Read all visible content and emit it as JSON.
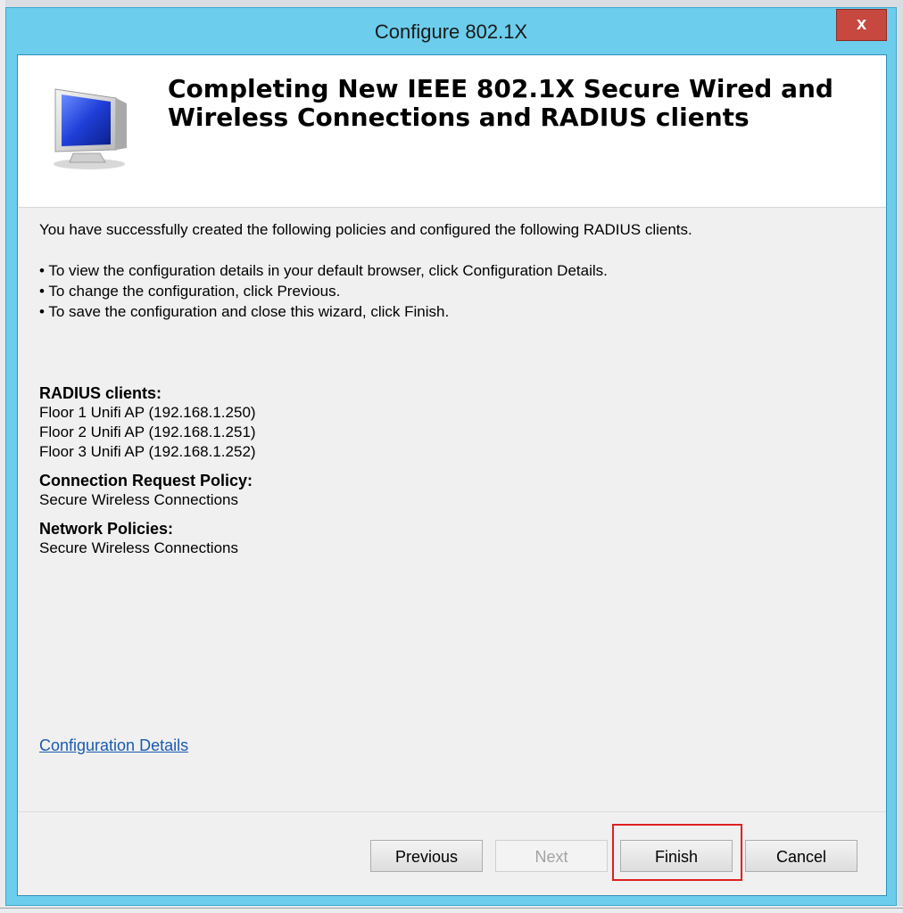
{
  "window": {
    "title": "Configure 802.1X",
    "close_label": "x"
  },
  "header": {
    "heading": "Completing New IEEE 802.1X Secure Wired and Wireless Connections and RADIUS clients",
    "icon": "computer-monitor-icon"
  },
  "body": {
    "intro": "You have successfully created the following policies and configured the following RADIUS clients.",
    "bullets": [
      "• To view the configuration details in your default browser, click Configuration Details.",
      "• To change the configuration, click Previous.",
      "• To save the configuration and close this wizard, click Finish."
    ]
  },
  "summary": {
    "radius_label": "RADIUS clients:",
    "radius_clients": [
      "Floor 1 Unifi AP (192.168.1.250)",
      "Floor 2 Unifi AP (192.168.1.251)",
      "Floor 3 Unifi AP (192.168.1.252)"
    ],
    "crp_label": "Connection Request Policy:",
    "crp_value": "Secure Wireless Connections",
    "np_label": "Network Policies:",
    "np_value": "Secure Wireless Connections"
  },
  "links": {
    "config_details": "Configuration Details"
  },
  "buttons": {
    "previous": "Previous",
    "next": "Next",
    "finish": "Finish",
    "cancel": "Cancel"
  },
  "colors": {
    "titlebar": "#6ccdec",
    "close": "#c7483f",
    "highlight": "#e02020",
    "link": "#1a5bb0"
  }
}
